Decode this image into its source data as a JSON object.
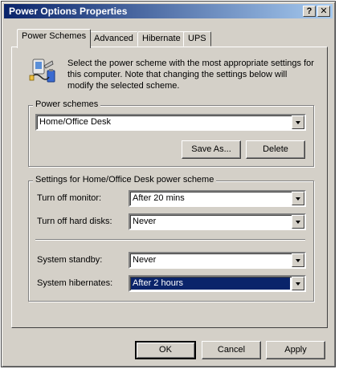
{
  "window": {
    "title": "Power Options Properties"
  },
  "title_buttons": {
    "help": "?",
    "close": "✕"
  },
  "tabs": [
    {
      "label": "Power Schemes",
      "active": true
    },
    {
      "label": "Advanced",
      "active": false
    },
    {
      "label": "Hibernate",
      "active": false
    },
    {
      "label": "UPS",
      "active": false
    }
  ],
  "intro": {
    "text": "Select the power scheme with the most appropriate settings for this computer. Note that changing the settings below will modify the selected scheme.",
    "icon": "power-scheme-icon"
  },
  "power_schemes": {
    "group_label": "Power schemes",
    "selected": "Home/Office Desk",
    "save_as_label": "Save As...",
    "delete_label": "Delete"
  },
  "settings": {
    "group_label": "Settings for Home/Office Desk power scheme",
    "turn_off_monitor": {
      "label": "Turn off monitor:",
      "value": "After 20 mins"
    },
    "turn_off_hard_disks": {
      "label": "Turn off hard disks:",
      "value": "Never"
    },
    "system_standby": {
      "label": "System standby:",
      "value": "Never"
    },
    "system_hibernates": {
      "label": "System hibernates:",
      "value": "After 2 hours"
    }
  },
  "footer": {
    "ok_label": "OK",
    "cancel_label": "Cancel",
    "apply_label": "Apply"
  },
  "colors": {
    "titlebar_start": "#0a246a",
    "titlebar_end": "#a6caf0",
    "face": "#d4d0c8",
    "selection": "#0a246a"
  }
}
